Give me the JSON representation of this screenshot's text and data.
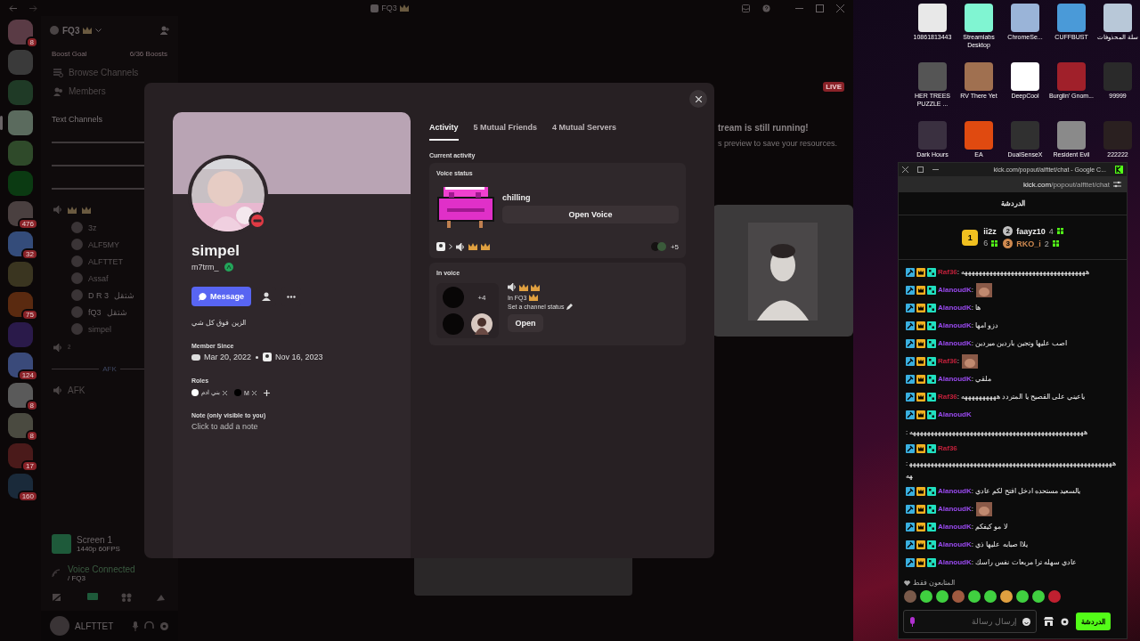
{
  "discord": {
    "window_title": "FQ3",
    "servers": [
      {
        "selected": false,
        "color": "#5a3b45",
        "badge": "8"
      },
      {
        "selected": false,
        "color": "#3a3a3a"
      },
      {
        "selected": false,
        "color": "#1f3a26"
      },
      {
        "selected": true,
        "color": "#5b6b5e"
      },
      {
        "selected": false,
        "color": "#2f4a2a"
      },
      {
        "selected": false,
        "color": "#0b3a12"
      },
      {
        "selected": false,
        "color": "#4a4040",
        "badge": "476"
      },
      {
        "selected": false,
        "color": "#344c7a",
        "badge": "32"
      },
      {
        "selected": false,
        "color": "#3a3520"
      },
      {
        "selected": false,
        "color": "#5a2a10",
        "badge": "75"
      },
      {
        "selected": false,
        "color": "#2a1a4a"
      },
      {
        "selected": false,
        "color": "#3a4a7a",
        "badge": "124"
      },
      {
        "selected": false,
        "color": "#5a5a5a",
        "badge": "8"
      },
      {
        "selected": false,
        "color": "#4a4a40",
        "badge": "8"
      },
      {
        "selected": false,
        "color": "#4a1a1a",
        "badge": "17"
      },
      {
        "selected": false,
        "color": "#1a2a3a",
        "badge": "160"
      }
    ],
    "server_name": "FQ3",
    "boost": {
      "label": "Boost Goal",
      "count": "6/36 Boosts"
    },
    "nav": [
      {
        "label": "Browse Channels",
        "kind": "browse"
      },
      {
        "label": "Members",
        "kind": "members"
      }
    ],
    "category": "Text Channels",
    "voice_channels": [
      {
        "members": [
          {
            "name": "3z",
            "dim": false
          },
          {
            "name": "ALF5MY",
            "dim": false
          },
          {
            "name": "ALFTTET",
            "dim": false
          },
          {
            "name": "Assaf",
            "dim": false
          },
          {
            "name": "D R 3",
            "note": "شتقل",
            "dim": true
          },
          {
            "name": "fQ3",
            "note": "شتقل",
            "dim": true
          },
          {
            "name": "simpel",
            "dim": false
          }
        ]
      },
      {
        "name": "²"
      }
    ],
    "afk_divider": "AFK",
    "afk_channel": "AFK",
    "stream": {
      "title": "Screen 1",
      "quality": "1440p 60FPS"
    },
    "voice_connected": {
      "status": "Voice Connected",
      "channel": "/ FQ3"
    },
    "user": {
      "name": "ALFTTET"
    },
    "main": {
      "live": "LIVE",
      "notice_title": "tream is still running!",
      "notice_text": "s preview to save your resources."
    }
  },
  "profile": {
    "display_name": "simpel",
    "username": "m7trm_",
    "message_button": "Message",
    "bio": "الزين فوق كل شي",
    "member_since_label": "Member Since",
    "discord_date": "Mar 20, 2022",
    "server_date": "Nov 16, 2023",
    "roles_label": "Roles",
    "roles": [
      {
        "name": "بني ادم",
        "color": "#ffffff"
      },
      {
        "name": "M",
        "color": "#000000"
      }
    ],
    "note_label": "Note (only visible to you)",
    "note_placeholder": "Click to add a note",
    "tabs": [
      {
        "label": "Activity",
        "selected": true
      },
      {
        "label": "5 Mutual Friends",
        "selected": false
      },
      {
        "label": "4 Mutual Servers",
        "selected": false
      }
    ],
    "current_activity_label": "Current activity",
    "voice_status": {
      "label": "Voice status",
      "status": "chilling",
      "button": "Open Voice",
      "extra_count": "+5"
    },
    "in_voice": {
      "label": "In voice",
      "extra_count": "+4",
      "server": "In FQ3",
      "set_status": "Set a channel status",
      "button": "Open"
    }
  },
  "desktop_icons": [
    {
      "label": "10861813443",
      "color": "#e8e8e8"
    },
    {
      "label": "Streamlabs Desktop",
      "color": "#80f5d2"
    },
    {
      "label": "ChromeSe...",
      "color": "#9ab4d8"
    },
    {
      "label": "CUFFBUST",
      "color": "#4a9ad8"
    },
    {
      "label": "سلة المحذوفات",
      "color": "#b8c8d8"
    },
    {
      "label": "HER TREES PUZZLE ...",
      "color": "#555555"
    },
    {
      "label": "RV There Yet",
      "color": "#a07050"
    },
    {
      "label": "DeepCool",
      "color": "#ffffff"
    },
    {
      "label": "Burglin' Gnom...",
      "color": "#a0202a"
    },
    {
      "label": "99999",
      "color": "#2a2a2a"
    },
    {
      "label": "Dark Hours",
      "color": "#3a3040"
    },
    {
      "label": "EA",
      "color": "#e04a10"
    },
    {
      "label": "DualSenseX",
      "color": "#303030"
    },
    {
      "label": "Resident Evil",
      "color": "#8a8a8a"
    },
    {
      "label": "222222",
      "color": "#2a2020"
    }
  ],
  "chat_window": {
    "title": "kick.com/popout/alfttet/chat - Google C...",
    "url_host": "kick.com",
    "url_path": "/popout/alfttet/chat",
    "header": "الدردشة",
    "leaders": [
      {
        "rank": "1",
        "name": "ii2z",
        "count": "6",
        "color": "#f0c020"
      },
      {
        "rank": "2",
        "name": "faayz10",
        "count": "4",
        "color": "#c0c0c0"
      },
      {
        "rank": "3",
        "name": "RKO_i",
        "count": "2",
        "color": "#d08a50"
      }
    ],
    "messages": [
      {
        "user": "Raf36",
        "color": "#c0203a",
        "kind": "text",
        "text": ": هههههههههههههههههههههههههههههههههههه"
      },
      {
        "user": "AlanoudK",
        "color": "#9a4af0",
        "kind": "emote",
        "text": ":"
      },
      {
        "user": "AlanoudK",
        "color": "#9a4af0",
        "kind": "text",
        "text": ": ها"
      },
      {
        "user": "AlanoudK",
        "color": "#9a4af0",
        "kind": "text",
        "text": ": دزو امها"
      },
      {
        "user": "AlanoudK",
        "color": "#9a4af0",
        "kind": "text",
        "text": ": اصب عليها وتجين باردين ميردين"
      },
      {
        "user": "Raf36",
        "color": "#c0203a",
        "kind": "emote",
        "text": ":"
      },
      {
        "user": "AlanoudK",
        "color": "#9a4af0",
        "kind": "text",
        "text": ": ملقي"
      },
      {
        "user": "Raf36",
        "color": "#c0203a",
        "kind": "text",
        "text": ": ياعيني على القصيح يا المتردد ههههههههههه"
      },
      {
        "user": "AlanoudK",
        "color": "#9a4af0",
        "kind": "text",
        "text": ": هههههههههههههههههههههههههههههههههههههههههههههههههه"
      },
      {
        "user": "Raf36",
        "color": "#c0203a",
        "kind": "text",
        "text": ": هههههههههههههههههههههههههههههههههههههههههههههههههههههههههههه"
      },
      {
        "user": "AlanoudK",
        "color": "#9a4af0",
        "kind": "text",
        "text": ": يالسعيد مستحده ادخل افتح لكم عادي"
      },
      {
        "user": "AlanoudK",
        "color": "#9a4af0",
        "kind": "emote",
        "text": ":"
      },
      {
        "user": "AlanoudK",
        "color": "#9a4af0",
        "kind": "text",
        "text": ": لا مو كيفكم"
      },
      {
        "user": "AlanoudK",
        "color": "#9a4af0",
        "kind": "text",
        "text": ": يلاا صبابه عليها ذي"
      },
      {
        "user": "AlanoudK",
        "color": "#9a4af0",
        "kind": "text",
        "text": ": عادي سهله ترا مربعات نفس راسك"
      }
    ],
    "followers_only": "المتابعون فقط",
    "input_placeholder": "إرسال رسالة",
    "send_button": "الدردشة"
  }
}
